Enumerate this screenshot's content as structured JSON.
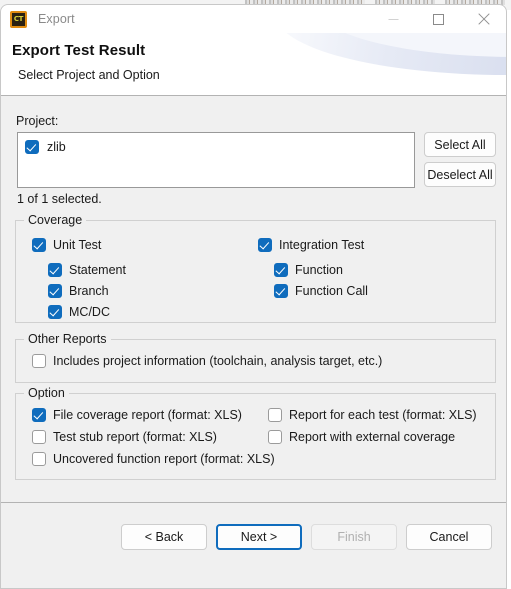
{
  "window": {
    "title": "Export",
    "app_icon": "CT",
    "icon_name": "ct-app-icon",
    "controls": [
      {
        "name": "minimize-button",
        "glyph": "minimize-icon"
      },
      {
        "name": "maximize-button",
        "glyph": "maximize-icon"
      },
      {
        "name": "close-button",
        "glyph": "close-icon"
      }
    ]
  },
  "header": {
    "title": "Export Test Result",
    "subtitle": "Select Project and Option"
  },
  "project": {
    "label": "Project:",
    "items": [
      {
        "label": "zlib",
        "checked": true
      }
    ],
    "select_all_label": "Select All",
    "deselect_all_label": "Deselect All",
    "status": "1 of 1 selected."
  },
  "coverage": {
    "title": "Coverage",
    "left_column": [
      {
        "label": "Unit Test",
        "checked": true,
        "indent": 0
      },
      {
        "label": "Statement",
        "checked": true,
        "indent": 1
      },
      {
        "label": "Branch",
        "checked": true,
        "indent": 1
      },
      {
        "label": "MC/DC",
        "checked": true,
        "indent": 1
      }
    ],
    "right_column": [
      {
        "label": "Integration Test",
        "checked": true,
        "indent": 0
      },
      {
        "label": "Function",
        "checked": true,
        "indent": 1
      },
      {
        "label": "Function Call",
        "checked": true,
        "indent": 1
      }
    ]
  },
  "other_reports": {
    "title": "Other Reports",
    "items": [
      {
        "label": "Includes project information (toolchain, analysis target, etc.)",
        "checked": false
      }
    ]
  },
  "option": {
    "title": "Option",
    "left_column": [
      {
        "label": "File coverage report (format: XLS)",
        "checked": true
      },
      {
        "label": "Test stub report (format: XLS)",
        "checked": false
      },
      {
        "label": "Uncovered function report (format: XLS)",
        "checked": false
      }
    ],
    "right_column": [
      {
        "label": "Report for each test (format: XLS)",
        "checked": false
      },
      {
        "label": "Report with external coverage",
        "checked": false
      }
    ]
  },
  "footer": {
    "buttons": [
      {
        "name": "back-button",
        "label": "< Back",
        "state": "enabled"
      },
      {
        "name": "next-button",
        "label": "Next >",
        "state": "default"
      },
      {
        "name": "finish-button",
        "label": "Finish",
        "state": "disabled"
      },
      {
        "name": "cancel-button",
        "label": "Cancel",
        "state": "enabled"
      }
    ]
  },
  "colors": {
    "accent": "#0f6cbd",
    "dialog_bg": "#f0f0f0",
    "header_bg": "#ffffff",
    "icon_border": "#e08c12"
  }
}
